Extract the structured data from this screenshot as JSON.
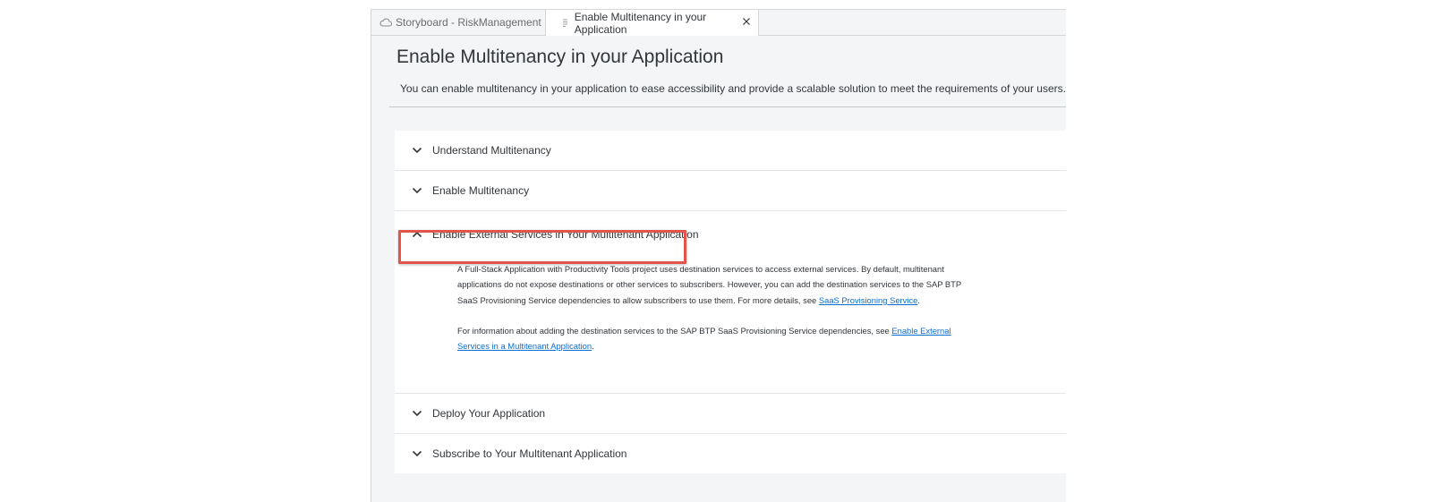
{
  "tabs": [
    {
      "label": "Storyboard - RiskManagement",
      "icon": "cloud-icon",
      "active": false
    },
    {
      "label": "Enable Multitenancy in your Application",
      "icon": "document-icon",
      "active": true,
      "close_icon": "close-icon"
    }
  ],
  "page": {
    "title": "Enable Multitenancy in your Application",
    "subtitle": "You can enable multitenancy in your application to ease accessibility and provide a scalable solution to meet the requirements of your users."
  },
  "sections": [
    {
      "title": "Understand Multitenancy",
      "expanded": false
    },
    {
      "title": "Enable Multitenancy",
      "expanded": false
    },
    {
      "title": "Enable External Services in Your Multitenant Application",
      "expanded": true,
      "highlighted": true,
      "paragraph1": {
        "text": "A Full-Stack Application with Productivity Tools project uses destination services to access external services. By default, multitenant applications do not expose destinations or other services to subscribers. However, you can add the destination services to the SAP BTP SaaS Provisioning Service dependencies to allow subscribers to use them. For more details, see ",
        "link": "SaaS Provisioning Service",
        "suffix": "."
      },
      "paragraph2": {
        "text": "For information about adding the destination services to the SAP BTP SaaS Provisioning Service dependencies, see ",
        "link": "Enable External Services in a Multitenant Application",
        "suffix": "."
      }
    },
    {
      "title": "Deploy Your Application",
      "expanded": false
    },
    {
      "title": "Subscribe to Your Multitenant Application",
      "expanded": false
    }
  ],
  "colors": {
    "highlight_border": "#e2554a",
    "link": "#0a6ed1",
    "panel_bg": "#ffffff",
    "page_bg": "#f4f5f6"
  }
}
